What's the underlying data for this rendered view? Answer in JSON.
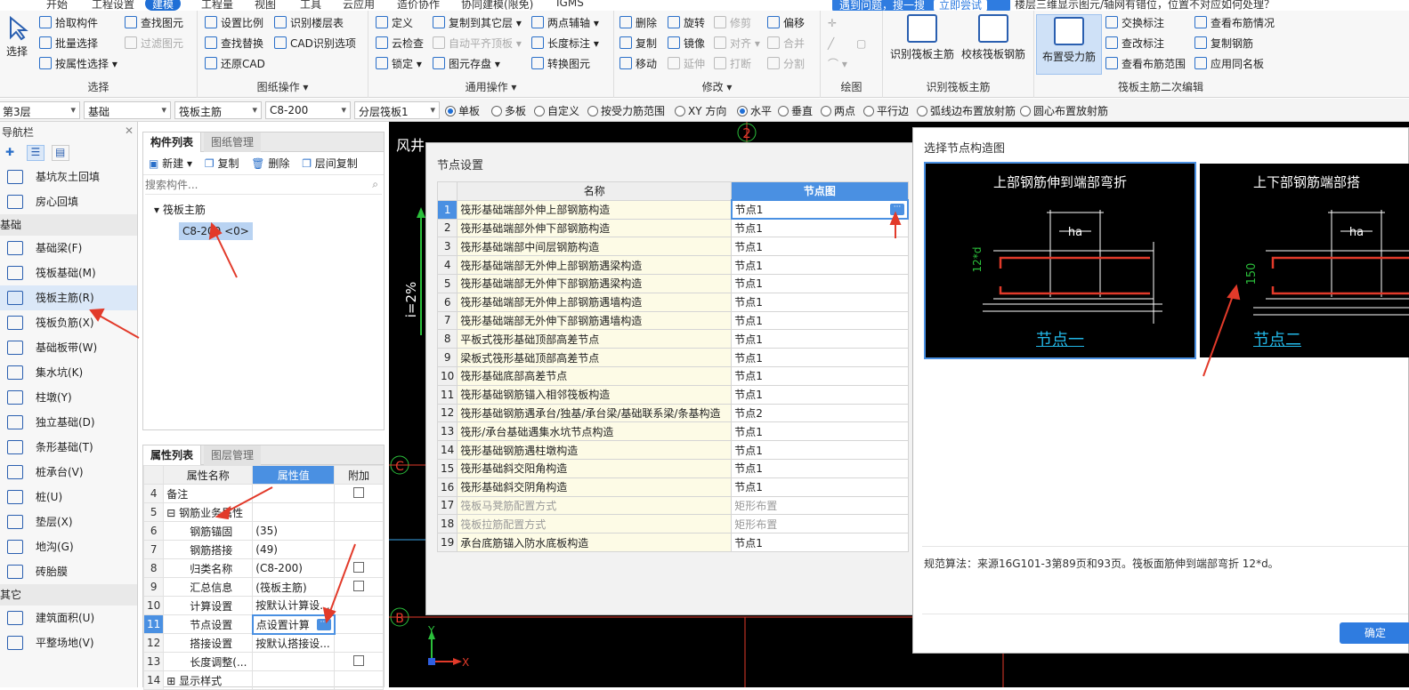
{
  "top_tabs": [
    "开始",
    "工程设置",
    "建模",
    "工程量",
    "视图",
    "工具",
    "云应用",
    "造价协作",
    "协同建模(限免)",
    "IGMS"
  ],
  "tip_banner": {
    "text": "遇到问题，搜一搜",
    "button": "立即尝试"
  },
  "question_text": "楼层三维显示图元/轴网有错位，位置不对应如何处理？",
  "ribbon": {
    "select_group": {
      "title": "选择",
      "big_button": "选择",
      "items": [
        "拾取构件",
        "批量选择",
        "按属性选择",
        "查找图元",
        "过滤图元"
      ]
    },
    "drawing_ops": {
      "title": "图纸操作",
      "items": [
        "设置比例",
        "识别楼层表",
        "查找替换",
        "CAD识别选项",
        "还原CAD"
      ]
    },
    "common_ops": {
      "title": "通用操作",
      "items": [
        "定义",
        "复制到其它层",
        "两点辅轴",
        "云检查",
        "自动平齐顶板",
        "长度标注",
        "锁定",
        "图元存盘",
        "转换图元"
      ]
    },
    "modify": {
      "title": "修改",
      "items": [
        "删除",
        "旋转",
        "修剪",
        "偏移",
        "复制",
        "镜像",
        "对齐",
        "合并",
        "移动",
        "延伸",
        "打断",
        "分割"
      ]
    },
    "draw": {
      "title": "绘图"
    },
    "identify_raft": {
      "title": "识别筏板主筋",
      "buttons": [
        "识别筏板主筋",
        "校核筏板钢筋"
      ]
    },
    "raft_edit": {
      "title": "筏板主筋二次编辑",
      "big_button": "布置受力筋",
      "items": [
        "交换标注",
        "查看布筋情况",
        "查改标注",
        "复制钢筋",
        "查看布筋范围",
        "应用同名板"
      ]
    }
  },
  "toolbar2": {
    "floor": "第3层",
    "category": "基础",
    "type": "筏板主筋",
    "spec": "C8-200",
    "layer": "分层筏板1",
    "radios": [
      "单板",
      "多板",
      "自定义",
      "按受力筋范围",
      "XY 方向",
      "水平",
      "垂直",
      "两点",
      "平行边",
      "弧线边布置放射筋",
      "圆心布置放射筋"
    ]
  },
  "navbar": {
    "title": "导航栏",
    "items_top": [
      "基坑灰土回填",
      "房心回填"
    ],
    "cat_foundation": "基础",
    "foundation_items": [
      "基础梁(F)",
      "筏板基础(M)",
      "筏板主筋(R)",
      "筏板负筋(X)",
      "基础板带(W)",
      "集水坑(K)",
      "柱墩(Y)",
      "独立基础(D)",
      "条形基础(T)",
      "桩承台(V)",
      "桩(U)",
      "垫层(X)",
      "地沟(G)",
      "砖胎膜"
    ],
    "cat_other": "其它",
    "other_items": [
      "建筑面积(U)",
      "平整场地(V)"
    ]
  },
  "component_panel": {
    "tabs": [
      "构件列表",
      "图纸管理"
    ],
    "actions": [
      "新建",
      "复制",
      "删除",
      "层间复制"
    ],
    "search_placeholder": "搜索构件...",
    "tree_root": "筏板主筋",
    "tree_child": "C8-200 <0>"
  },
  "property_panel": {
    "tabs": [
      "属性列表",
      "图层管理"
    ],
    "headers": [
      "属性名称",
      "属性值",
      "附加"
    ],
    "rows": [
      {
        "n": "4",
        "name": "备注",
        "value": ""
      },
      {
        "n": "5",
        "name": "钢筋业务属性",
        "value": ""
      },
      {
        "n": "6",
        "name": "钢筋锚固",
        "value": "(35)"
      },
      {
        "n": "7",
        "name": "钢筋搭接",
        "value": "(49)"
      },
      {
        "n": "8",
        "name": "归类名称",
        "value": "(C8-200)"
      },
      {
        "n": "9",
        "name": "汇总信息",
        "value": "(筏板主筋)"
      },
      {
        "n": "10",
        "name": "计算设置",
        "value": "按默认计算设..."
      },
      {
        "n": "11",
        "name": "节点设置",
        "value": "点设置计算"
      },
      {
        "n": "12",
        "name": "搭接设置",
        "value": "按默认搭接设..."
      },
      {
        "n": "13",
        "name": "长度调整(...",
        "value": ""
      },
      {
        "n": "14",
        "name": "显示样式",
        "value": ""
      }
    ]
  },
  "cad_labels": {
    "axis2": "2",
    "axisC": "C",
    "axisB": "B",
    "slope": "i=2%",
    "text1": "风井",
    "y": "Y",
    "x": "X"
  },
  "node_dialog": {
    "title": "节点设置",
    "headers": [
      "名称",
      "节点图"
    ],
    "rows": [
      {
        "n": "1",
        "name": "筏形基础端部外伸上部钢筋构造",
        "value": "节点1"
      },
      {
        "n": "2",
        "name": "筏形基础端部外伸下部钢筋构造",
        "value": "节点1"
      },
      {
        "n": "3",
        "name": "筏形基础端部中间层钢筋构造",
        "value": "节点1"
      },
      {
        "n": "4",
        "name": "筏形基础端部无外伸上部钢筋遇梁构造",
        "value": "节点1"
      },
      {
        "n": "5",
        "name": "筏形基础端部无外伸下部钢筋遇梁构造",
        "value": "节点1"
      },
      {
        "n": "6",
        "name": "筏形基础端部无外伸上部钢筋遇墙构造",
        "value": "节点1"
      },
      {
        "n": "7",
        "name": "筏形基础端部无外伸下部钢筋遇墙构造",
        "value": "节点1"
      },
      {
        "n": "8",
        "name": "平板式筏形基础顶部高差节点",
        "value": "节点1"
      },
      {
        "n": "9",
        "name": "梁板式筏形基础顶部高差节点",
        "value": "节点1"
      },
      {
        "n": "10",
        "name": "筏形基础底部高差节点",
        "value": "节点1"
      },
      {
        "n": "11",
        "name": "筏形基础钢筋锚入相邻筏板构造",
        "value": "节点1"
      },
      {
        "n": "12",
        "name": "筏形基础钢筋遇承台/独基/承台梁/基础联系梁/条基构造",
        "value": "节点2"
      },
      {
        "n": "13",
        "name": "筏形/承台基础遇集水坑节点构造",
        "value": "节点1"
      },
      {
        "n": "14",
        "name": "筏形基础钢筋遇柱墩构造",
        "value": "节点1"
      },
      {
        "n": "15",
        "name": "筏形基础斜交阳角构造",
        "value": "节点1"
      },
      {
        "n": "16",
        "name": "筏形基础斜交阴角构造",
        "value": "节点1"
      },
      {
        "n": "17",
        "name": "筏板马凳筋配置方式",
        "value": "矩形布置"
      },
      {
        "n": "18",
        "name": "筏板拉筋配置方式",
        "value": "矩形布置"
      },
      {
        "n": "19",
        "name": "承台底筋锚入防水底板构造",
        "value": "节点1"
      }
    ]
  },
  "select_dialog": {
    "title": "选择节点构造图",
    "cards": [
      {
        "title": "上部钢筋伸到端部弯折",
        "link": "节点一",
        "dim_label": "12*d",
        "ha": "ha"
      },
      {
        "title": "上下部钢筋端部搭",
        "link": "节点二",
        "dim_label": "150",
        "ha": "ha"
      }
    ],
    "rule_text": "规范算法：来源16G101-3第89页和93页。筏板面筋伸到端部弯折 12*d。",
    "ok_button": "确定"
  },
  "colors": {
    "accent": "#1f6fd6",
    "annotation_red": "#e23a2a",
    "cad_bg": "#000000",
    "link_cyan": "#22b8e8"
  }
}
